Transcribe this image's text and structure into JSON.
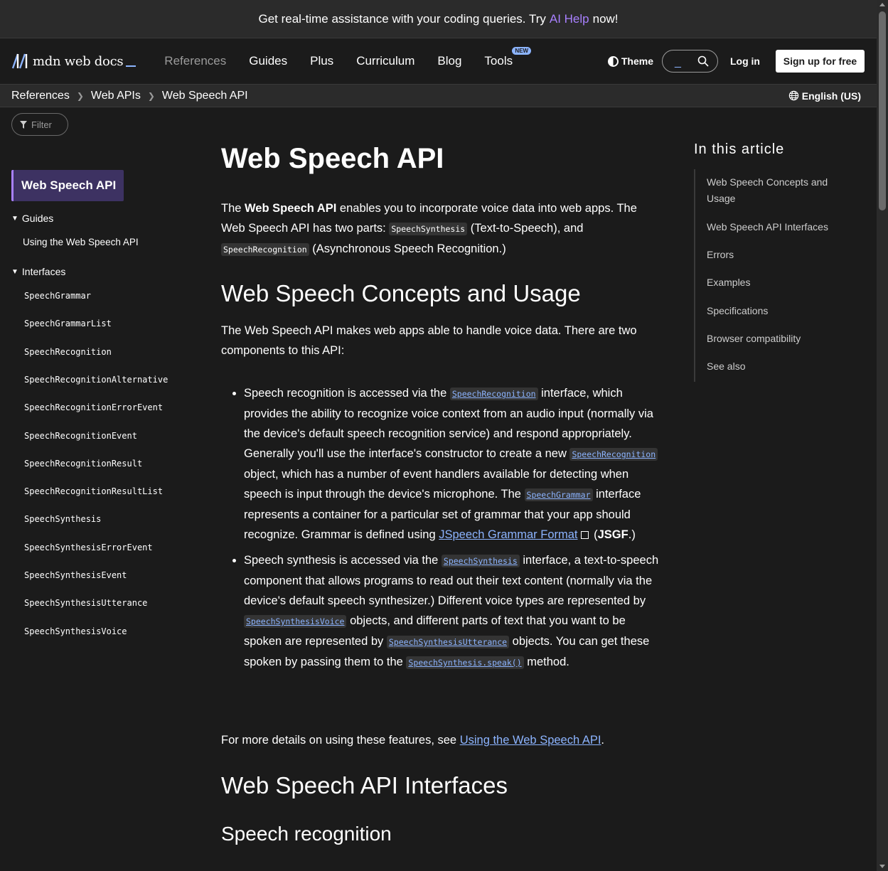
{
  "banner": {
    "text_before": "Get real-time assistance with your coding queries. Try",
    "link": "AI Help",
    "text_after": "now!"
  },
  "nav": {
    "logo_text": "mdn web docs",
    "items": [
      {
        "label": "References"
      },
      {
        "label": "Guides"
      },
      {
        "label": "Plus"
      },
      {
        "label": "Curriculum"
      },
      {
        "label": "Blog"
      },
      {
        "label": "Tools",
        "badge": "NEW"
      }
    ],
    "theme_label": "Theme",
    "login_label": "Log in",
    "signup_label": "Sign up for free"
  },
  "breadcrumbs": [
    "References",
    "Web APIs",
    "Web Speech API"
  ],
  "language": "English (US)",
  "sidebar": {
    "filter_placeholder": "Filter",
    "current": "Web Speech API",
    "guides_heading": "Guides",
    "guides": [
      "Using the Web Speech API"
    ],
    "interfaces_heading": "Interfaces",
    "interfaces": [
      "SpeechGrammar",
      "SpeechGrammarList",
      "SpeechRecognition",
      "SpeechRecognitionAlternative",
      "SpeechRecognitionErrorEvent",
      "SpeechRecognitionEvent",
      "SpeechRecognitionResult",
      "SpeechRecognitionResultList",
      "SpeechSynthesis",
      "SpeechSynthesisErrorEvent",
      "SpeechSynthesisEvent",
      "SpeechSynthesisUtterance",
      "SpeechSynthesisVoice"
    ]
  },
  "article": {
    "title": "Web Speech API",
    "intro": {
      "t1": "The ",
      "bold": "Web Speech API",
      "t2": " enables you to incorporate voice data into web apps. The Web Speech API has two parts: ",
      "code1": "SpeechSynthesis",
      "t3": " (Text-to-Speech), and ",
      "code2": "SpeechRecognition",
      "t4": " (Asynchronous Speech Recognition.)"
    },
    "h2_concepts": "Web Speech Concepts and Usage",
    "concepts_intro": "The Web Speech API makes web apps able to handle voice data. There are two components to this API:",
    "bullet1": {
      "t1": "Speech recognition is accessed via the ",
      "c1": "SpeechRecognition",
      "t2": " interface, which provides the ability to recognize voice context from an audio input (normally via the device's default speech recognition service) and respond appropriately. Generally you'll use the interface's constructor to create a new ",
      "c2": "SpeechRecognition",
      "t3": " object, which has a number of event handlers available for detecting when speech is input through the device's microphone. The ",
      "c3": "SpeechGrammar",
      "t4": " interface represents a container for a particular set of grammar that your app should recognize. Grammar is defined using ",
      "link": "JSpeech Grammar Format",
      "t5": " (",
      "bold": "JSGF",
      "t6": ".)"
    },
    "bullet2": {
      "t1": "Speech synthesis is accessed via the ",
      "c1": "SpeechSynthesis",
      "t2": " interface, a text-to-speech component that allows programs to read out their text content (normally via the device's default speech synthesizer.) Different voice types are represented by ",
      "c2": "SpeechSynthesisVoice",
      "t3": " objects, and different parts of text that you want to be spoken are represented by ",
      "c3": "SpeechSynthesisUtterance",
      "t4": " objects. You can get these spoken by passing them to the ",
      "c4": "SpeechSynthesis.speak()",
      "t5": " method."
    },
    "more": {
      "t1": "For more details on using these features, see ",
      "link": "Using the Web Speech API",
      "t2": "."
    },
    "h2_interfaces": "Web Speech API Interfaces",
    "h3_recognition": "Speech recognition"
  },
  "toc": {
    "title": "In this article",
    "items": [
      "Web Speech Concepts and Usage",
      "Web Speech API Interfaces",
      "Errors",
      "Examples",
      "Specifications",
      "Browser compatibility",
      "See also"
    ]
  },
  "colors": {
    "accent": "#a880ff",
    "link": "#8cb4ff",
    "background": "#1b1b1b"
  }
}
